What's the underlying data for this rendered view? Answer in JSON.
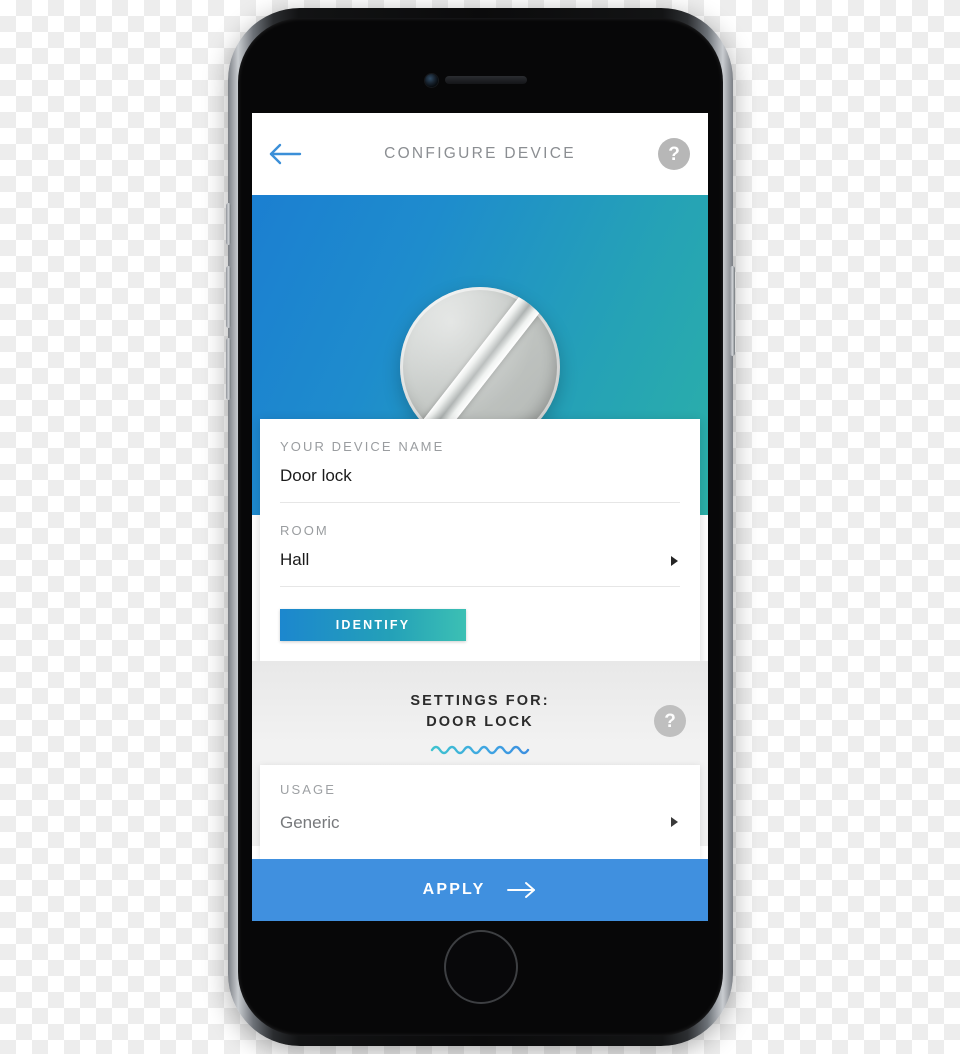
{
  "appbar": {
    "title": "CONFIGURE DEVICE",
    "back_icon": "arrow-left-icon",
    "help_label": "?"
  },
  "hero": {
    "device_image_alt": "door-lock-thumb-turn"
  },
  "device_card": {
    "name_field": {
      "label": "YOUR DEVICE NAME",
      "value": "Door lock"
    },
    "room_field": {
      "label": "ROOM",
      "value": "Hall",
      "chevron_icon": "chevron-right-icon"
    },
    "identify_label": "IDENTIFY"
  },
  "settings": {
    "heading_line1": "SETTINGS FOR:",
    "heading_line2": "DOOR LOCK",
    "wave_icon": "wavy-divider-icon",
    "help_label": "?"
  },
  "usage_card": {
    "label": "USAGE",
    "value": "Generic",
    "chevron_icon": "chevron-right-icon"
  },
  "apply": {
    "label": "APPLY",
    "arrow_icon": "arrow-right-icon"
  },
  "colors": {
    "accent_blue": "#4090df",
    "gradient_start": "#1b7fd1",
    "gradient_end": "#2bb0a8",
    "help_gray": "#b7b7b7",
    "label_gray": "#9a9da0",
    "text_dark": "#1b1b1b"
  }
}
